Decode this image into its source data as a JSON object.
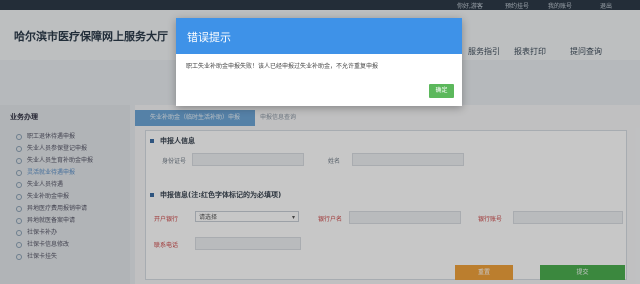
{
  "topbar": {
    "items": [
      "你好,游客",
      "预约挂号",
      "我的账号",
      "退出"
    ]
  },
  "header": {
    "site_title": "哈尔滨市医疗保障网上服务大厅",
    "nav": [
      "服务指引",
      "报表打印",
      "提问查询"
    ]
  },
  "sidebar": {
    "heading": "业务办理",
    "items": [
      {
        "label": "职工退休待遇申报"
      },
      {
        "label": "失业人员参保登记申报"
      },
      {
        "label": "失业人员生育补助金申报"
      },
      {
        "label": "灵活就业待遇申报",
        "active": true
      },
      {
        "label": "失业人员待遇"
      },
      {
        "label": "失业补助金申报"
      },
      {
        "label": "异地医疗费用报销申请"
      },
      {
        "label": "异地就医备案申请"
      },
      {
        "label": "社保卡补办"
      },
      {
        "label": "社保卡信息修改"
      },
      {
        "label": "社保卡挂失"
      }
    ]
  },
  "tabs": {
    "active": "失业补助金（临时生活补助）申报",
    "other": "申报信息查询"
  },
  "form": {
    "section1": "申报人信息",
    "id_label": "身份证号",
    "name_label": "姓名",
    "section2": "申报信息(注:红色字体标记的为必填项)",
    "bank_label": "开户银行",
    "bank_value": "请选择",
    "account_name_label": "银行户名",
    "account_no_label": "银行账号",
    "phone_label": "联系电话",
    "reset_button": "重置",
    "submit_button": "提交"
  },
  "modal": {
    "title": "错误提示",
    "message": "职工失业补助金申报失败！该人已经申报过失业补助金，不允许重复申报",
    "ok_button": "确定"
  },
  "colors": {
    "modal_header": "#3e92e8",
    "ok_button": "#5cb85c",
    "tab_active": "#6ea6d6",
    "reset_button": "#f0a23c",
    "submit_button": "#4caf50"
  }
}
